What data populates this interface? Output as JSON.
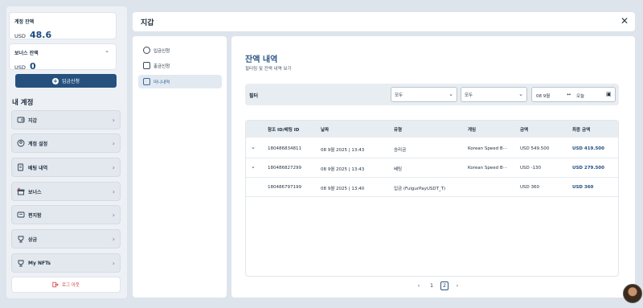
{
  "wallet": {
    "balance_label": "계정 잔액",
    "balance_currency": "USD",
    "balance_value": "48.6",
    "bonus_label": "보너스 잔액",
    "bonus_currency": "USD",
    "bonus_value": "0",
    "deposit_button": "입금신청"
  },
  "account": {
    "title": "내 계정",
    "items": [
      {
        "label": "지갑",
        "icon": "wallet-icon"
      },
      {
        "label": "계정 설정",
        "icon": "user-settings-icon"
      },
      {
        "label": "베팅 내역",
        "icon": "bet-history-icon"
      },
      {
        "label": "보너스",
        "icon": "gift-icon"
      },
      {
        "label": "편지함",
        "icon": "inbox-icon"
      },
      {
        "label": "상금",
        "icon": "trophy-icon"
      },
      {
        "label": "My NFTs",
        "icon": "nft-icon"
      }
    ],
    "logout": "로그 아웃"
  },
  "header": {
    "title": "지갑",
    "close_icon": "close-icon"
  },
  "subnav": {
    "items": [
      {
        "label": "입금신청"
      },
      {
        "label": "출금신청"
      },
      {
        "label": "머니내역"
      }
    ],
    "active_index": 2
  },
  "content": {
    "title": "잔액 내역",
    "subtitle": "필터링 및 잔액 내역 보기",
    "filter": {
      "label": "필터",
      "select1": "모두",
      "select2": "모두",
      "date_from": "08 9월",
      "date_to": "오늘"
    },
    "table": {
      "headers": [
        "참조 ID/베팅 ID",
        "날짜",
        "유형",
        "게임",
        "금액",
        "최종 금액"
      ],
      "rows": [
        {
          "id": "180486834811",
          "date": "08 9월 2025 | 13:43",
          "type": "승리금",
          "game": "Korean Speed B···",
          "amount": "USD 549.500",
          "final": "USD 419.500",
          "expandable": true
        },
        {
          "id": "180486827299",
          "date": "08 9월 2025 | 13:43",
          "type": "베팅",
          "game": "Korean Speed B···",
          "amount": "USD -130",
          "final": "USD 279.500",
          "expandable": true
        },
        {
          "id": "180486797199",
          "date": "08 9월 2025 | 13:40",
          "type": "입금 (FulgurPayUSDT_T)",
          "game": "",
          "amount": "USD 360",
          "final": "USD 360",
          "expandable": false
        }
      ]
    },
    "pagination": {
      "prev": "‹",
      "pages": [
        "1",
        "2"
      ],
      "current": "2",
      "next": "›"
    }
  },
  "colors": {
    "primary": "#26517e",
    "accent_text": "#2b5685",
    "logout": "#d24040"
  }
}
